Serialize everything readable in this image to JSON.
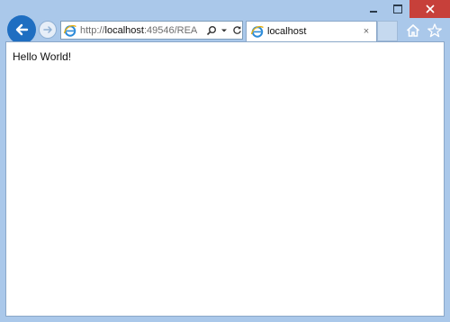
{
  "window": {
    "caption_buttons": [
      "minimize",
      "maximize",
      "close"
    ]
  },
  "navigation": {
    "back_icon": "back-arrow-icon",
    "forward_icon": "forward-arrow-icon",
    "address": {
      "protocol": "http://",
      "host": "localhost",
      "rest": ":49546/REA",
      "icons": [
        "ie-logo-icon",
        "search-icon",
        "dropdown-icon",
        "refresh-icon"
      ]
    }
  },
  "tabs": [
    {
      "label": "localhost",
      "close": "×"
    }
  ],
  "toolbar": {
    "icons": [
      "home-icon",
      "favorites-star-icon"
    ]
  },
  "page": {
    "text": "Hello World!"
  },
  "colors": {
    "frame": "#aac8ea",
    "back_button": "#1f6ec1",
    "close_button": "#c7403a"
  }
}
